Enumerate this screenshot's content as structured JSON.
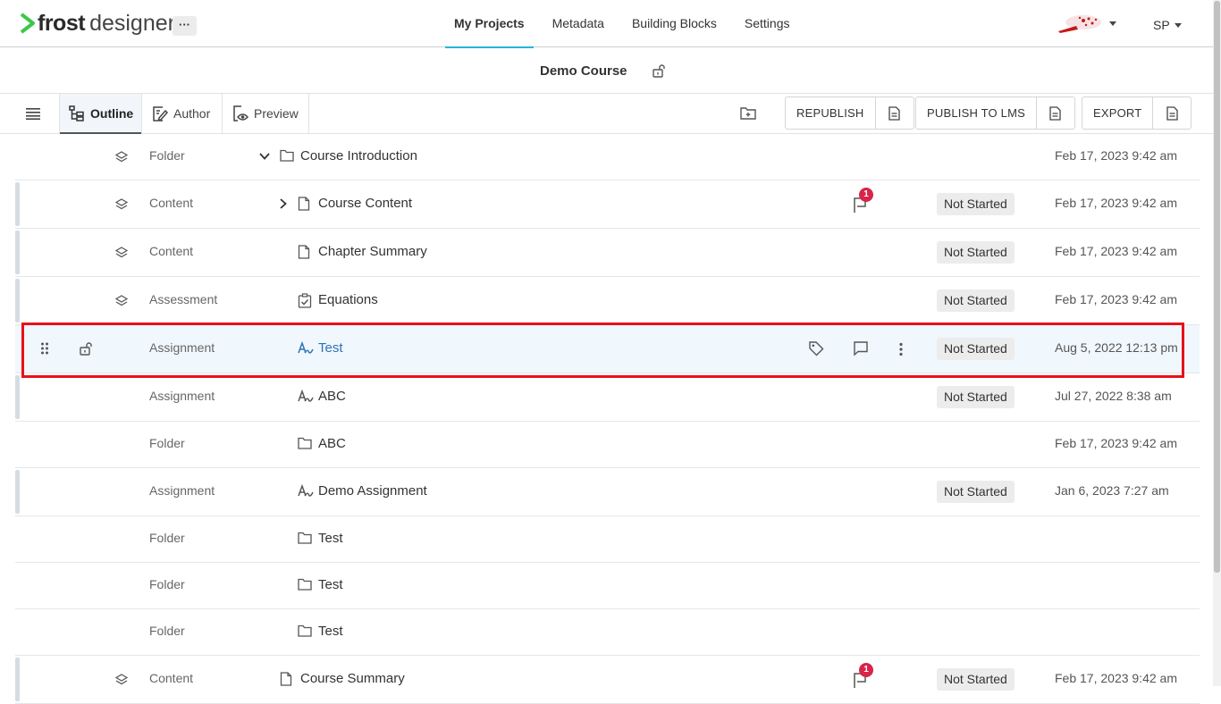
{
  "app": {
    "brand_bold": "frost",
    "brand_light": "designer",
    "more_label": "···"
  },
  "nav": {
    "tabs": [
      {
        "label": "My Projects",
        "active": true
      },
      {
        "label": "Metadata",
        "active": false
      },
      {
        "label": "Building Blocks",
        "active": false
      },
      {
        "label": "Settings",
        "active": false
      }
    ],
    "user_initials": "SP"
  },
  "course": {
    "title": "Demo Course"
  },
  "toolbar": {
    "views": [
      {
        "label": "Outline",
        "active": true
      },
      {
        "label": "Author",
        "active": false
      },
      {
        "label": "Preview",
        "active": false
      }
    ],
    "republish_label": "REPUBLISH",
    "publish_lms_label": "PUBLISH TO LMS",
    "export_label": "EXPORT"
  },
  "rows": [
    {
      "type": "Folder",
      "title": "Course Introduction",
      "icon": "folder-icon",
      "chevron": "down",
      "layers": true,
      "status": "",
      "date": "Feb 17, 2023 9:42 am",
      "comments": null,
      "bar": false,
      "selected": false
    },
    {
      "type": "Content",
      "title": "Course Content",
      "icon": "document-icon",
      "chevron": "right",
      "layers": true,
      "status": "Not Started",
      "date": "Feb 17, 2023 9:42 am",
      "comments": "1",
      "bar": true,
      "selected": false
    },
    {
      "type": "Content",
      "title": "Chapter Summary",
      "icon": "document-icon",
      "chevron": null,
      "layers": true,
      "status": "Not Started",
      "date": "Feb 17, 2023 9:42 am",
      "comments": null,
      "bar": true,
      "selected": false
    },
    {
      "type": "Assessment",
      "title": "Equations",
      "icon": "checklist-icon",
      "chevron": null,
      "layers": true,
      "status": "Not Started",
      "date": "Feb 17, 2023 9:42 am",
      "comments": null,
      "bar": true,
      "selected": false
    },
    {
      "type": "Assignment",
      "title": "Test",
      "icon": "assignment-icon",
      "chevron": null,
      "layers": false,
      "status": "Not Started",
      "date": "Aug 5, 2022 12:13 pm",
      "comments": null,
      "bar": false,
      "selected": true
    },
    {
      "type": "Assignment",
      "title": "ABC",
      "icon": "assignment-icon",
      "chevron": null,
      "layers": false,
      "status": "Not Started",
      "date": "Jul 27, 2022 8:38 am",
      "comments": null,
      "bar": true,
      "selected": false
    },
    {
      "type": "Folder",
      "title": "ABC",
      "icon": "folder-icon",
      "chevron": null,
      "layers": false,
      "status": "",
      "date": "Feb 17, 2023 9:42 am",
      "comments": null,
      "bar": false,
      "selected": false
    },
    {
      "type": "Assignment",
      "title": "Demo Assignment",
      "icon": "assignment-icon",
      "chevron": null,
      "layers": false,
      "status": "Not Started",
      "date": "Jan 6, 2023 7:27 am",
      "comments": null,
      "bar": true,
      "selected": false
    },
    {
      "type": "Folder",
      "title": "Test",
      "icon": "folder-icon",
      "chevron": null,
      "layers": false,
      "status": "",
      "date": "",
      "comments": null,
      "bar": false,
      "selected": false
    },
    {
      "type": "Folder",
      "title": "Test",
      "icon": "folder-icon",
      "chevron": null,
      "layers": false,
      "status": "",
      "date": "",
      "comments": null,
      "bar": false,
      "selected": false
    },
    {
      "type": "Folder",
      "title": "Test",
      "icon": "folder-icon",
      "chevron": null,
      "layers": false,
      "status": "",
      "date": "",
      "comments": null,
      "bar": false,
      "selected": false
    },
    {
      "type": "Content",
      "title": "Course Summary",
      "icon": "document-icon",
      "chevron": null,
      "layers": true,
      "status": "Not Started",
      "date": "Feb 17, 2023 9:42 am",
      "comments": "1",
      "bar": true,
      "selected": false
    }
  ],
  "colors": {
    "accent": "#22b8d4",
    "badge": "#d8244a",
    "selected_row": "#f0f7fd",
    "selected_text": "#2e73b6",
    "highlight_border": "#e8101a"
  }
}
